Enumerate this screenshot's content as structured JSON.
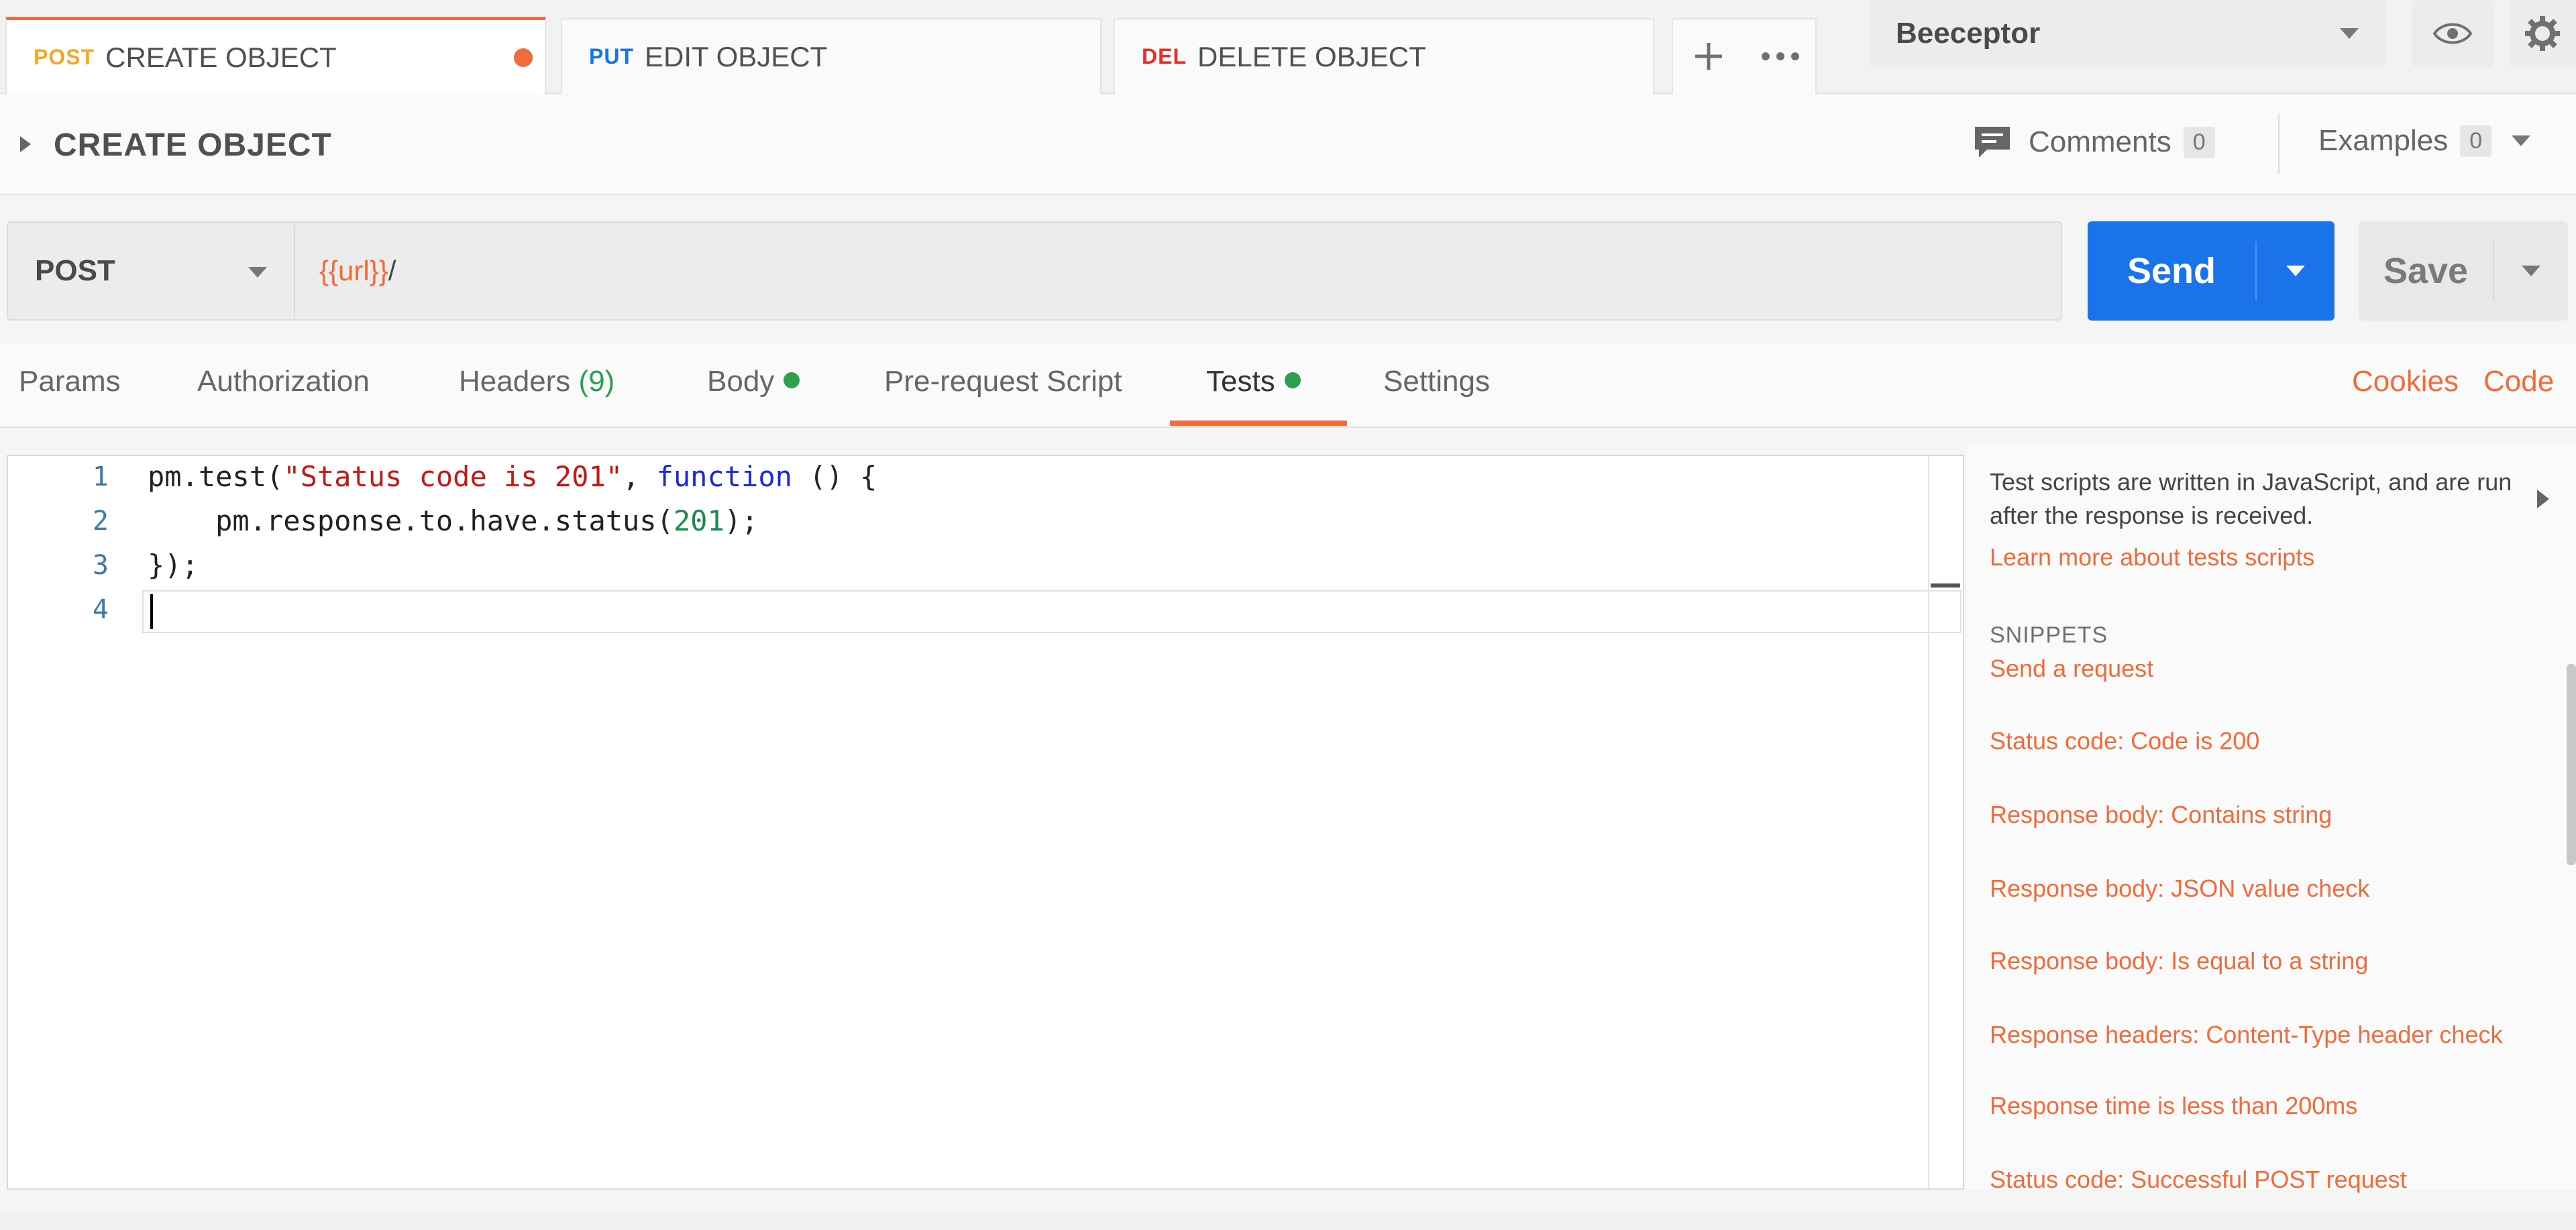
{
  "tabs": [
    {
      "method": "POST",
      "name": "CREATE OBJECT",
      "color": "#f5a623",
      "active": true,
      "unsaved": true
    },
    {
      "method": "PUT",
      "name": "EDIT OBJECT",
      "color": "#1a73e8"
    },
    {
      "method": "DEL",
      "name": "DELETE OBJECT",
      "color": "#e0322b"
    }
  ],
  "tab_actions": {
    "add_icon": "plus-icon",
    "more_icon": "ellipsis-icon"
  },
  "environment": {
    "selected": "Beeceptor",
    "eye_icon": "eye-icon",
    "settings_icon": "gear-icon"
  },
  "request": {
    "title": "CREATE OBJECT",
    "comments_label": "Comments",
    "comments_count": "0",
    "examples_label": "Examples",
    "examples_count": "0"
  },
  "url_bar": {
    "method": "POST",
    "url_variable": "{{url}}",
    "url_suffix": "/",
    "send_label": "Send",
    "save_label": "Save"
  },
  "request_tabs": {
    "params": "Params",
    "authorization": "Authorization",
    "headers": "Headers",
    "headers_count": "(9)",
    "body": "Body",
    "prerequest": "Pre-request Script",
    "tests": "Tests",
    "settings": "Settings",
    "cookies": "Cookies",
    "code": "Code"
  },
  "editor": {
    "line_numbers": [
      "1",
      "2",
      "3",
      "4"
    ],
    "line1": {
      "a": "pm.test(",
      "str": "\"Status code is 201\"",
      "b": ", ",
      "kw": "function",
      "c": " () {"
    },
    "line2": {
      "a": "    pm.response.to.have.status(",
      "num": "201",
      "b": ");"
    },
    "line3": "});"
  },
  "sidebar": {
    "description": "Test scripts are written in JavaScript, and are run after the response is received.",
    "learn_more": "Learn more about tests scripts",
    "snippets_heading": "SNIPPETS",
    "snippets": [
      "Send a request",
      "Status code: Code is 200",
      "Response body: Contains string",
      "Response body: JSON value check",
      "Response body: Is equal to a string",
      "Response headers: Content-Type header check",
      "Response time is less than 200ms",
      "Status code: Successful POST request"
    ]
  }
}
